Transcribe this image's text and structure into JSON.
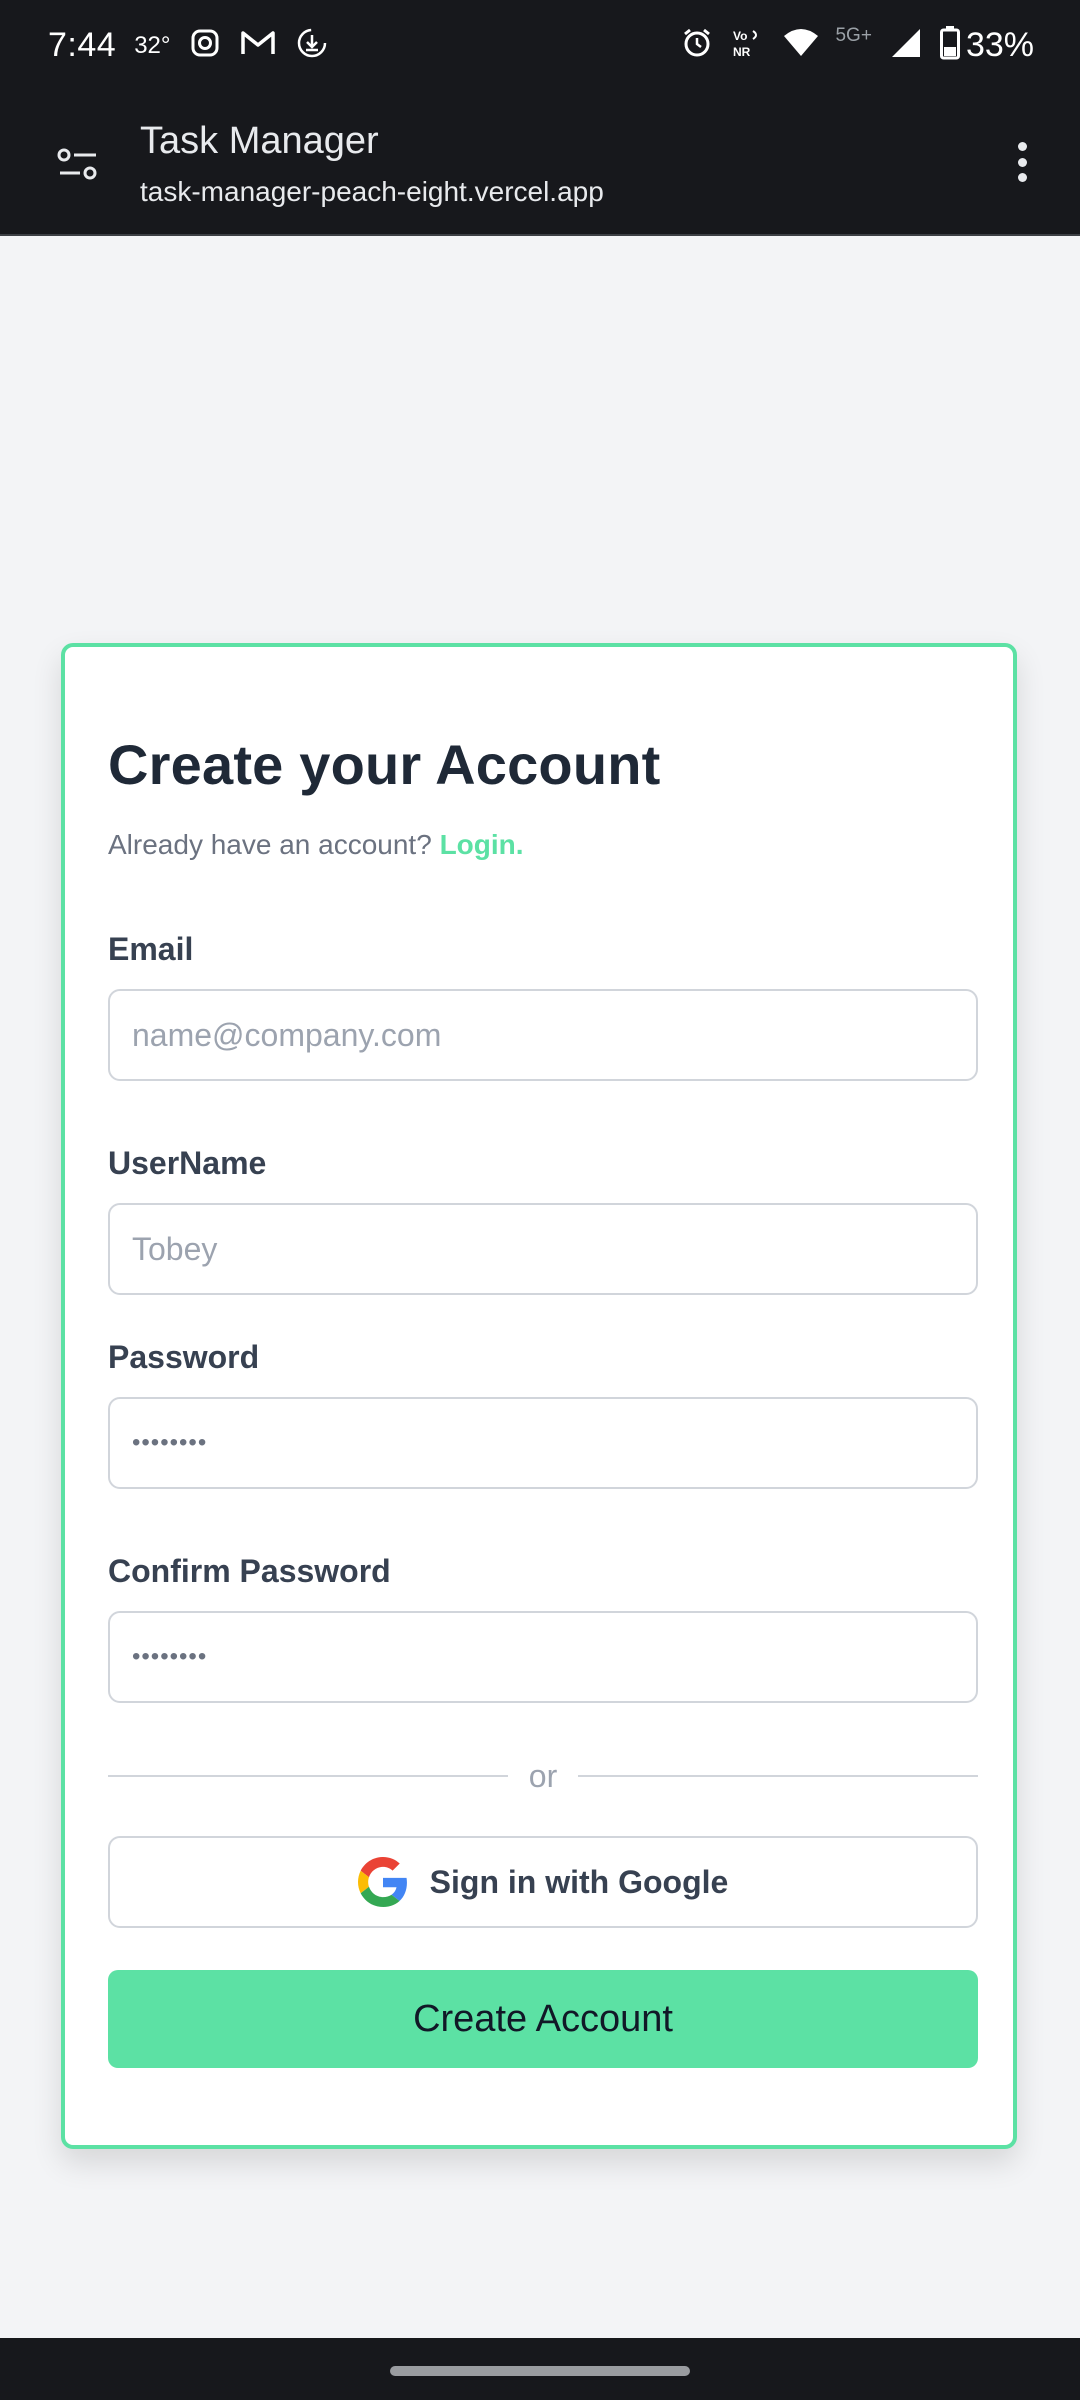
{
  "status_bar": {
    "time": "7:44",
    "temperature": "32°",
    "battery": "33%",
    "network_5g": "5G+",
    "icons": [
      "instagram-icon",
      "gmail-icon",
      "download-icon",
      "alarm-icon",
      "vonr-icon",
      "wifi-icon",
      "signal-icon",
      "battery-icon"
    ]
  },
  "browser": {
    "title": "Task Manager",
    "url": "task-manager-peach-eight.vercel.app"
  },
  "form": {
    "heading": "Create your Account",
    "login_prompt": "Already have an account?",
    "login_link": "Login.",
    "email_label": "Email",
    "email_placeholder": "name@company.com",
    "username_label": "UserName",
    "username_placeholder": "Tobey",
    "password_label": "Password",
    "password_value": "••••••••",
    "confirm_label": "Confirm Password",
    "confirm_value": "••••••••",
    "divider_text": "or",
    "google_label": "Sign in with Google",
    "submit_label": "Create Account"
  },
  "colors": {
    "accent": "#5ce1a4",
    "heading": "#1f2937",
    "chrome": "#17181c"
  }
}
